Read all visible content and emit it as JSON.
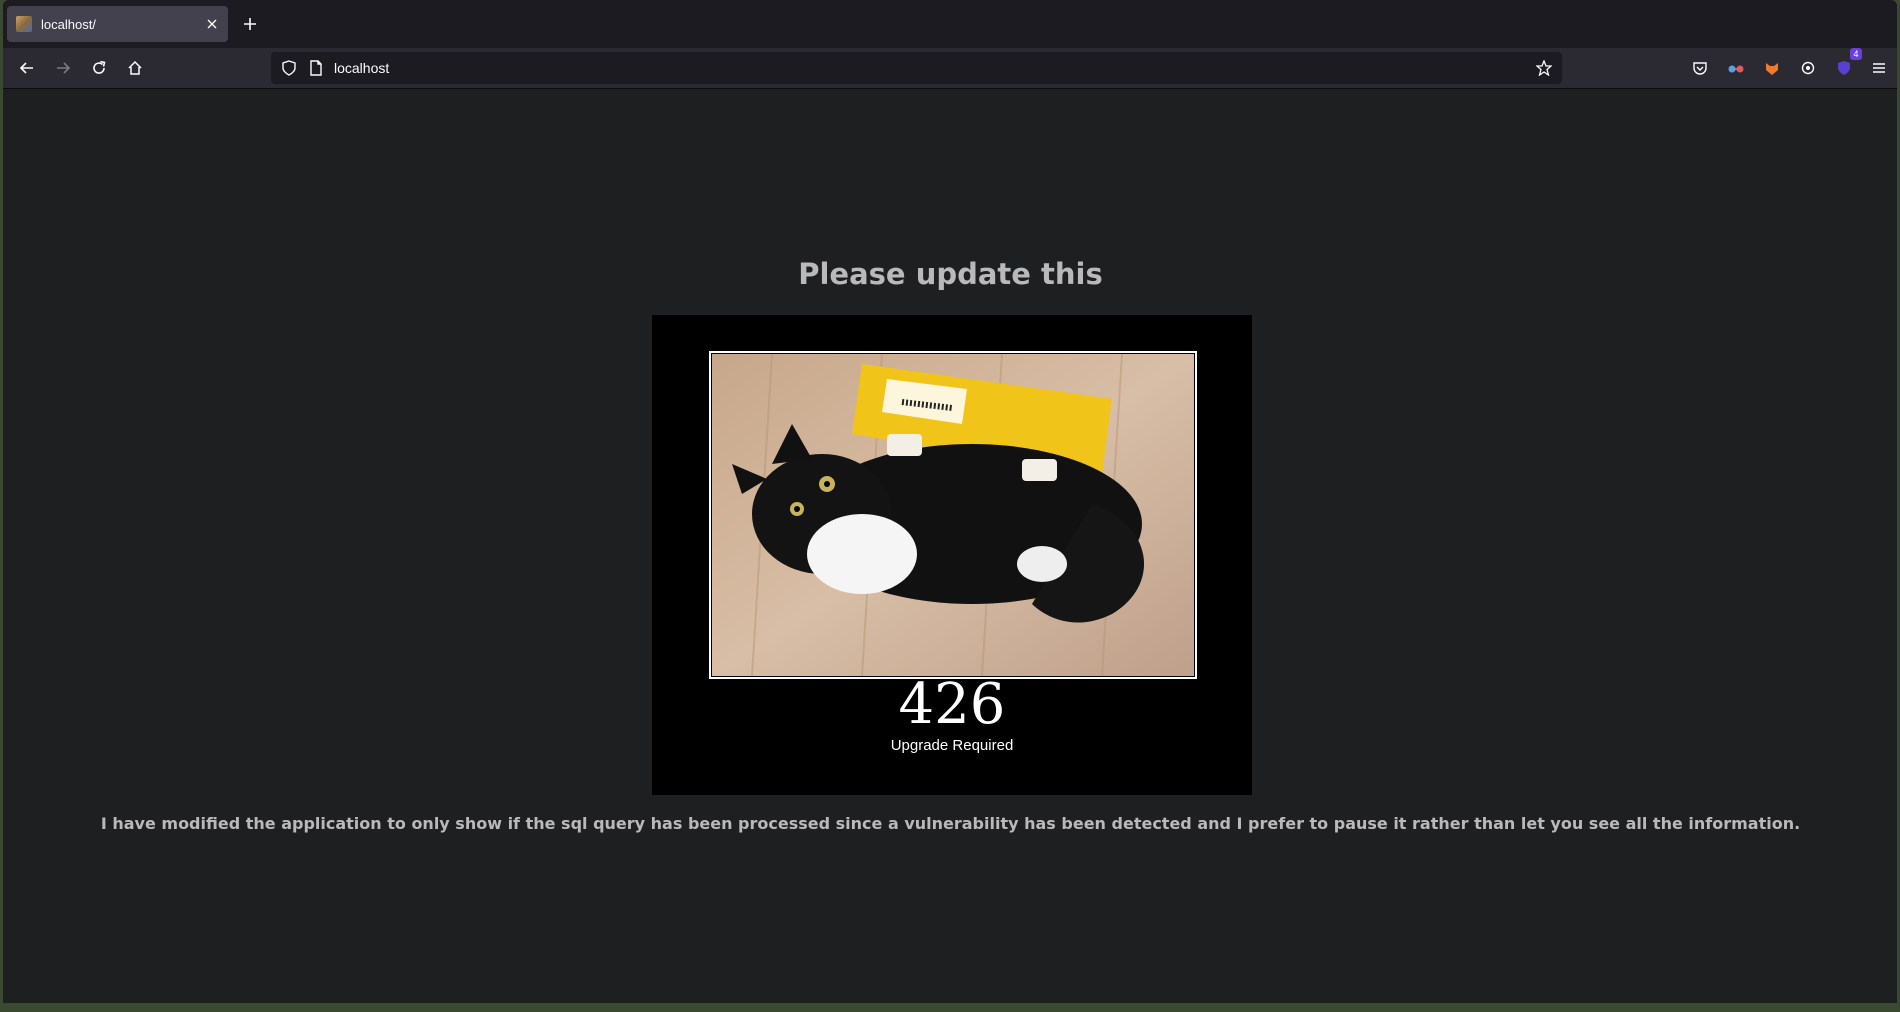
{
  "browser": {
    "tab": {
      "title": "localhost/",
      "favicon": "site-favicon"
    },
    "toolbar": {
      "back": "arrow-left-icon",
      "forward": "arrow-right-icon",
      "reload": "reload-icon",
      "home": "home-icon"
    },
    "urlbar": {
      "url": "localhost"
    },
    "extensions": {
      "pocket": "pocket-icon",
      "ext2": "glasses-icon",
      "ext3": "fox-icon",
      "ext4": "gear-icon",
      "ext5": {
        "icon": "shield-extension-icon",
        "badge": "4"
      },
      "menu": "hamburger-menu-icon"
    }
  },
  "page": {
    "heading": "Please update this",
    "poster": {
      "code": "426",
      "reason": "Upgrade Required"
    },
    "note": "I have modified the application to only show if the sql query has been processed since a vulnerability has been detected and I prefer to pause it rather than let you see all the information."
  },
  "colors": {
    "page_bg": "#1e1f21",
    "heading": "#b9b9b9",
    "toolbar": "#2b2a33",
    "tabstrip": "#1c1b22"
  }
}
